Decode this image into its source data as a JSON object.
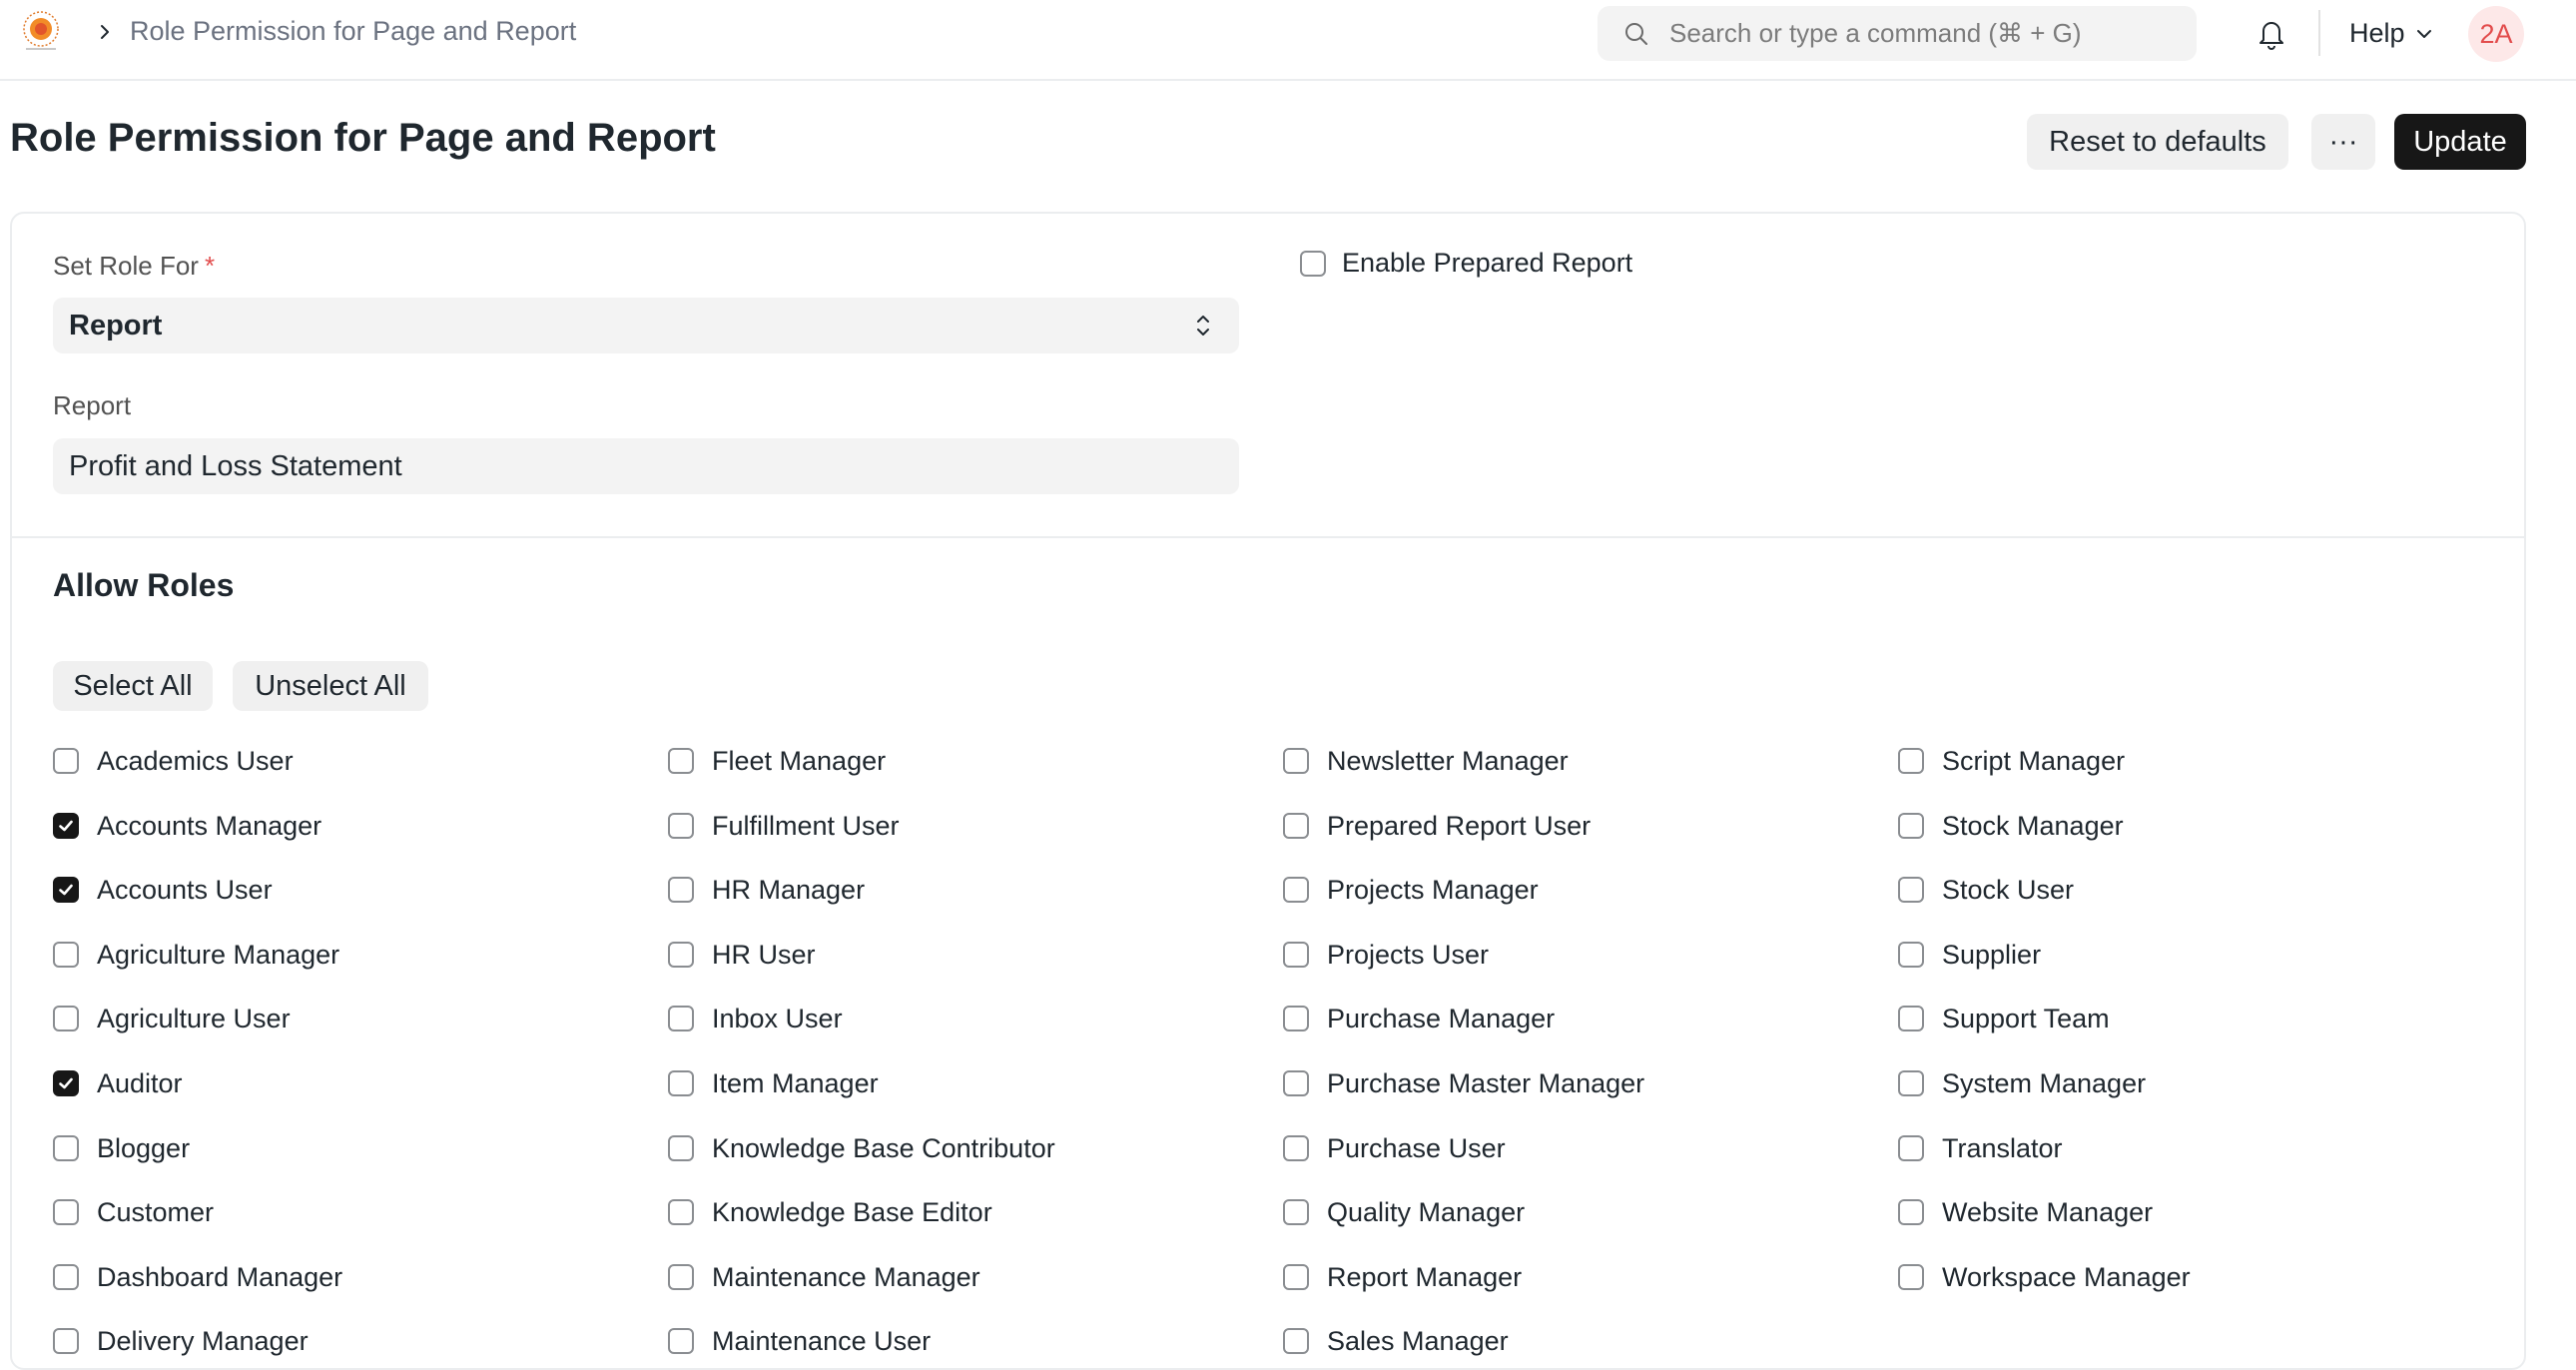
{
  "navbar": {
    "breadcrumb": "Role Permission for Page and Report",
    "search_placeholder": "Search or type a command (⌘ + G)",
    "help_label": "Help",
    "avatar_initials": "2A"
  },
  "page": {
    "title": "Role Permission for Page and Report",
    "reset_label": "Reset to defaults",
    "more_label": "···",
    "update_label": "Update"
  },
  "form": {
    "set_role_for_label": "Set Role For",
    "required_mark": "*",
    "set_role_for_value": "Report",
    "report_label": "Report",
    "report_value": "Profit and Loss Statement",
    "enable_prepared_report_label": "Enable Prepared Report",
    "enable_prepared_report_checked": false
  },
  "allow_roles": {
    "title": "Allow Roles",
    "select_all_label": "Select All",
    "unselect_all_label": "Unselect All",
    "columns": [
      [
        {
          "label": "Academics User",
          "checked": false
        },
        {
          "label": "Accounts Manager",
          "checked": true
        },
        {
          "label": "Accounts User",
          "checked": true
        },
        {
          "label": "Agriculture Manager",
          "checked": false
        },
        {
          "label": "Agriculture User",
          "checked": false
        },
        {
          "label": "Auditor",
          "checked": true
        },
        {
          "label": "Blogger",
          "checked": false
        },
        {
          "label": "Customer",
          "checked": false
        },
        {
          "label": "Dashboard Manager",
          "checked": false
        },
        {
          "label": "Delivery Manager",
          "checked": false
        }
      ],
      [
        {
          "label": "Fleet Manager",
          "checked": false
        },
        {
          "label": "Fulfillment User",
          "checked": false
        },
        {
          "label": "HR Manager",
          "checked": false
        },
        {
          "label": "HR User",
          "checked": false
        },
        {
          "label": "Inbox User",
          "checked": false
        },
        {
          "label": "Item Manager",
          "checked": false
        },
        {
          "label": "Knowledge Base Contributor",
          "checked": false
        },
        {
          "label": "Knowledge Base Editor",
          "checked": false
        },
        {
          "label": "Maintenance Manager",
          "checked": false
        },
        {
          "label": "Maintenance User",
          "checked": false
        }
      ],
      [
        {
          "label": "Newsletter Manager",
          "checked": false
        },
        {
          "label": "Prepared Report User",
          "checked": false
        },
        {
          "label": "Projects Manager",
          "checked": false
        },
        {
          "label": "Projects User",
          "checked": false
        },
        {
          "label": "Purchase Manager",
          "checked": false
        },
        {
          "label": "Purchase Master Manager",
          "checked": false
        },
        {
          "label": "Purchase User",
          "checked": false
        },
        {
          "label": "Quality Manager",
          "checked": false
        },
        {
          "label": "Report Manager",
          "checked": false
        },
        {
          "label": "Sales Manager",
          "checked": false
        }
      ],
      [
        {
          "label": "Script Manager",
          "checked": false
        },
        {
          "label": "Stock Manager",
          "checked": false
        },
        {
          "label": "Stock User",
          "checked": false
        },
        {
          "label": "Supplier",
          "checked": false
        },
        {
          "label": "Support Team",
          "checked": false
        },
        {
          "label": "System Manager",
          "checked": false
        },
        {
          "label": "Translator",
          "checked": false
        },
        {
          "label": "Website Manager",
          "checked": false
        },
        {
          "label": "Workspace Manager",
          "checked": false
        }
      ]
    ]
  }
}
